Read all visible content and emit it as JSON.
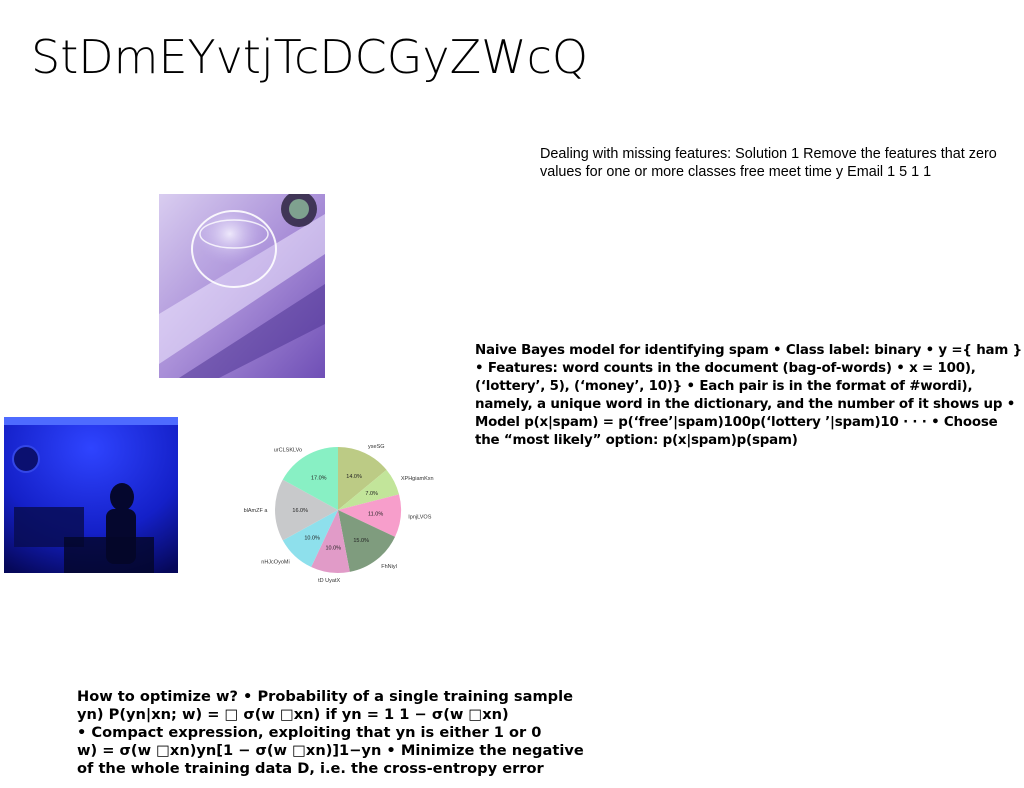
{
  "slide": {
    "title": "StDmEYvtjTcDCGyZWcQ",
    "text_missing_features": "Dealing with missing features: Solution 1 Remove the features that zero values for one or more classes free meet time y Email 1 5 1 1",
    "text_naive_bayes": "Naive Bayes model for identifying spam • Class label: binary • y ={ ham } • Features: word counts in the document (bag-of-words) • x = 100), (‘lottery’, 5), (‘money’, 10)} • Each pair is in the format of #wordi), namely, a unique word in the dictionary, and the number of it shows up • Model p(x|spam) = p(‘free’|spam)100p(‘lottery ’|spam)10 · · · • Choose the “most likely” option: p(x|spam)p(spam)",
    "text_optimize": "How to optimize w? • Probability of a single training sample\nyn) P(yn|xn; w) = □ σ(w □xn) if yn = 1 1 − σ(w □xn)\n• Compact expression, exploiting that yn is either 1 or 0\nw) = σ(w □xn)yn[1 − σ(w □xn)]1−yn • Minimize the negative\nof the whole training data D, i.e. the cross-entropy error"
  },
  "chart_data": {
    "type": "pie",
    "title": "",
    "slices": [
      {
        "label": "yseSG",
        "value": 14.0,
        "color": "#bccb85"
      },
      {
        "label": "XPHgiamKxn",
        "value": 7.0,
        "color": "#c2e59a"
      },
      {
        "label": "IpnjLVOS",
        "value": 11.0,
        "color": "#f79ecb"
      },
      {
        "label": "FhNiyl",
        "value": 15.0,
        "color": "#7f9c7e"
      },
      {
        "label": "tD UyatX",
        "value": 10.0,
        "color": "#e19bc8"
      },
      {
        "label": "nHJcOyoMi",
        "value": 10.0,
        "color": "#8ee0ec"
      },
      {
        "label": "blAmZF a",
        "value": 16.0,
        "color": "#c8c9cb"
      },
      {
        "label": "urCLSKLVo",
        "value": 17.0,
        "color": "#88f0c4"
      }
    ],
    "pct_labels": [
      "14.0%",
      "7.0%",
      "11.0%",
      "15.0%",
      "10.0%",
      "10.0%",
      "16.0%",
      "17.0%"
    ]
  }
}
